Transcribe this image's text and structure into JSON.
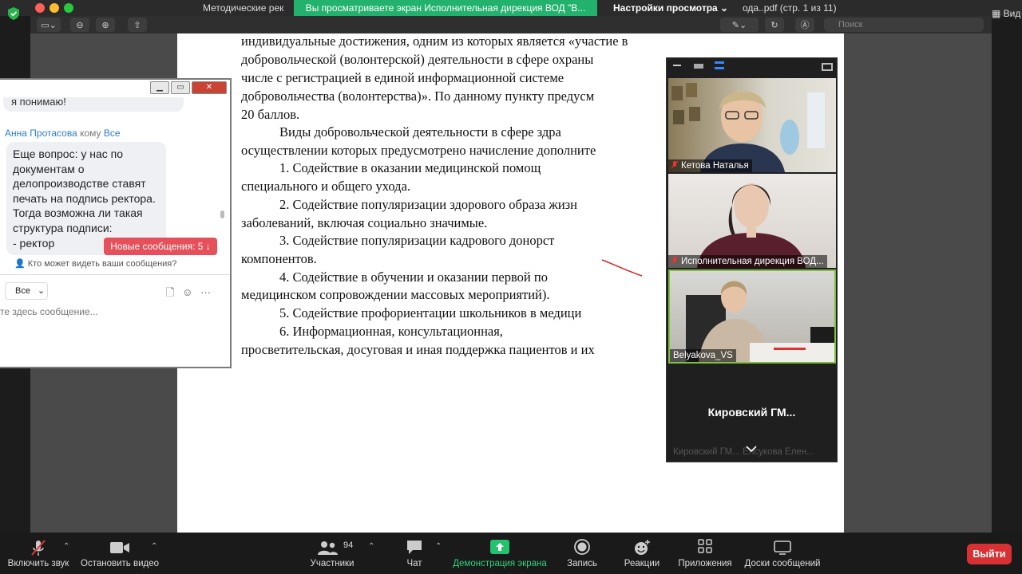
{
  "topbar": {
    "doc_title_left": "Методические рек",
    "share_banner": "Вы просматриваете экран Исполнительная дирекция ВОД \"В...",
    "view_options": "Настройки просмотра ⌄",
    "doc_title_right": "ода..pdf (стр. 1 из 11)",
    "view_button": "Вид",
    "search_placeholder": "Поиск"
  },
  "document": {
    "lines": [
      "индивидуальные    достижения,    одним    из    которых    является    «участие    в",
      "добровольческой (волонтерской) деятельности в сфере охраны",
      "числе с регистрацией в единой информационной системе",
      "добровольчества (волонтерства)». По данному пункту предусм",
      "20 баллов.",
      "Виды добровольческой деятельности в сфере здра",
      "осуществлении которых предусмотрено начисление дополните",
      "1.     Содействие   в   оказании   медицинской   помощ",
      "специального и общего ухода.",
      "2.     Содействие популяризации здорового образа жизн",
      "заболеваний, включая социально значимые.",
      "3.     Содействие   популяризации   кадрового   донорст",
      "компонентов.",
      "4.     Содействие в обучении и оказании первой   по",
      "медицинском сопровождении массовых мероприятий).",
      "5.     Содействие профориентации школьников в медици",
      "6.     Информационная,            консультационная,",
      "просветительская, досуговая и иная поддержка пациентов и их"
    ]
  },
  "chat": {
    "prev_bubble": "я понимаю!",
    "sender_name": "Анна Протасова",
    "sender_to": "кому",
    "sender_target": "Все",
    "message_lines": [
      "Еще вопрос: у нас по",
      "документам о",
      "делопроизводстве ставят",
      "печать на подпись ректора.",
      "Тогда возможна ли такая",
      "структура подписи:",
      "- ректор"
    ],
    "new_messages": "Новые сообщения: 5 ↓",
    "who_sees": "Кто может видеть ваши сообщения?",
    "to_select": "Все",
    "input_placeholder": "те здесь сообщение..."
  },
  "participants": {
    "tiles": [
      {
        "name": "Кетова Наталья"
      },
      {
        "name": "Исполнительная дирекция ВОД..."
      },
      {
        "name": "Belyakova_VS"
      }
    ],
    "big_name": "Кировский  ГМ...",
    "faded_names": "Кировский ГМ...   Елсукова Елен..."
  },
  "bottombar": {
    "mute": "Включить звук",
    "video": "Остановить видео",
    "participants": "Участники",
    "participants_count": "94",
    "chat": "Чат",
    "share": "Демонстрация экрана",
    "record": "Запись",
    "reactions": "Реакции",
    "apps": "Приложения",
    "whiteboards": "Доски сообщений",
    "leave": "Выйти"
  },
  "colors": {
    "share_green": "#23b26d",
    "leave_red": "#d83134",
    "new_msg_red": "#e5505a",
    "link_blue": "#2d7bd6"
  }
}
